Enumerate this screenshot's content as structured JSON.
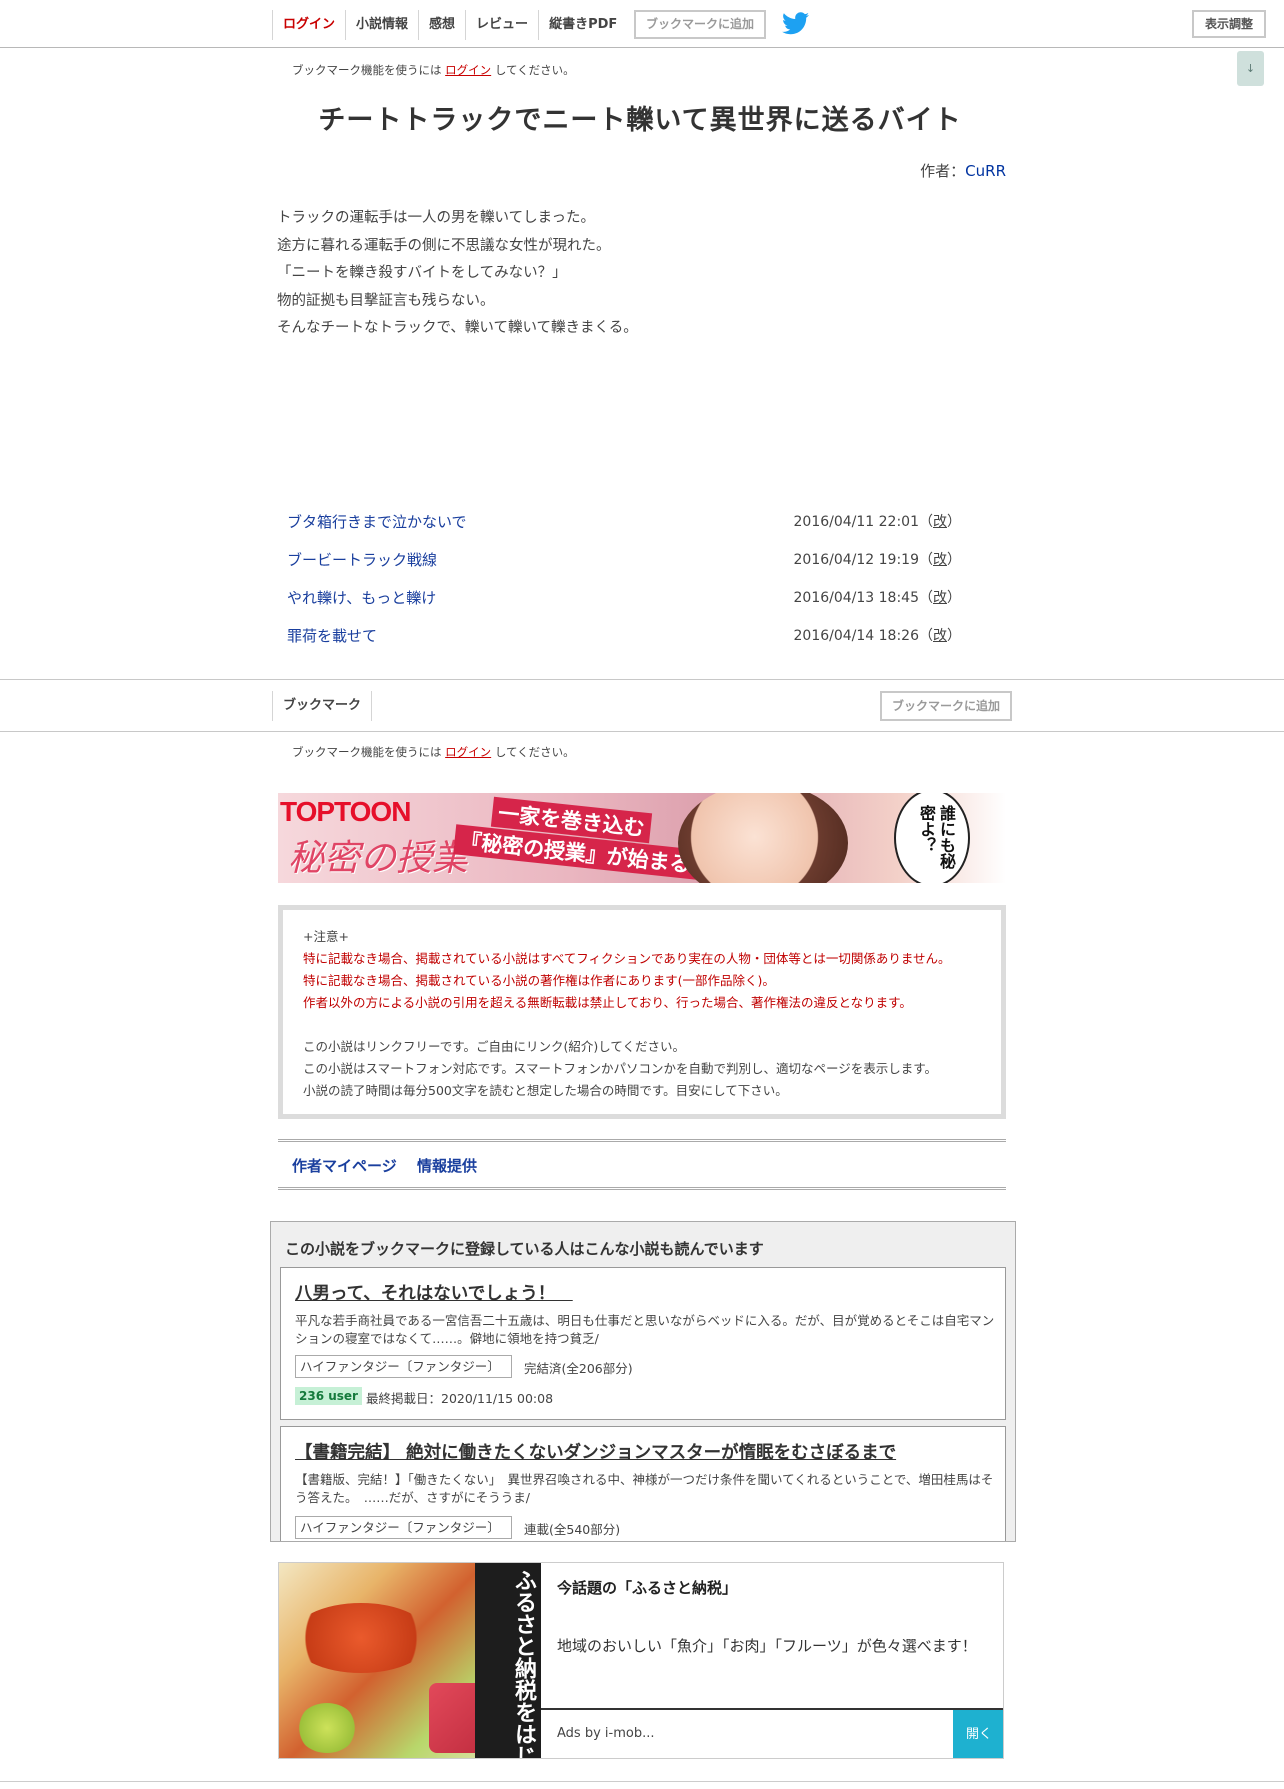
{
  "nav": {
    "items": [
      "ログイン",
      "小説情報",
      "感想",
      "レビュー",
      "縦書きPDF"
    ],
    "bookmark_add": "ブックマークに追加",
    "display_settings": "表示調整",
    "scroll_down": "↓"
  },
  "login_hint": {
    "prefix": "ブックマーク機能を使うには",
    "link": "ログイン",
    "suffix": "してください。"
  },
  "novel": {
    "title": "チートトラックでニート轢いて異世界に送るバイト",
    "author_label": "作者：",
    "author": "CuRR",
    "synopsis": [
      "トラックの運転手は一人の男を轢いてしまった。",
      "途方に暮れる運転手の側に不思議な女性が現れた。",
      "「ニートを轢き殺すバイトをしてみない？」",
      "物的証拠も目撃証言も残らない。",
      "そんなチートなトラックで、轢いて轢いて轢きまくる。"
    ]
  },
  "chapters": [
    {
      "title": "ブタ箱行きまで泣かないで",
      "date": "2016/04/11 22:01",
      "kai": "改"
    },
    {
      "title": "ブービートラック戦線",
      "date": "2016/04/12 19:19",
      "kai": "改"
    },
    {
      "title": "やれ轢け、もっと轢け",
      "date": "2016/04/13 18:45",
      "kai": "改"
    },
    {
      "title": "罪荷を載せて",
      "date": "2016/04/14 18:26",
      "kai": "改"
    }
  ],
  "bookmark_bar": {
    "tab": "ブックマーク",
    "add": "ブックマークに追加"
  },
  "ad_banner": {
    "logo": "TOPTOON",
    "logo_sub": "秘密の授業",
    "catch1": "一家を巻き込む",
    "catch2": "『秘密の授業』が始まる！",
    "bubble": "誰にも秘密よ？"
  },
  "notice": {
    "heading": "+注意+",
    "red_lines": [
      "特に記載なき場合、掲載されている小説はすべてフィクションであり実在の人物・団体等とは一切関係ありません。",
      "特に記載なき場合、掲載されている小説の著作権は作者にあります(一部作品除く)。",
      "作者以外の方による小説の引用を超える無断転載は禁止しており、行った場合、著作権法の違反となります。"
    ],
    "lines": [
      "この小説はリンクフリーです。ご自由にリンク(紹介)してください。",
      "この小説はスマートフォン対応です。スマートフォンかパソコンかを自動で判別し、適切なページを表示します。",
      "小説の読了時間は毎分500文字を読むと想定した場合の時間です。目安にして下さい。"
    ]
  },
  "author_links": {
    "mypage": "作者マイページ",
    "info": "情報提供"
  },
  "recommend": {
    "heading": "この小説をブックマークに登録している人はこんな小説も読んでいます",
    "items": [
      {
        "title": "八男って、それはないでしょう！　",
        "desc": "平凡な若手商社員である一宮信吾二十五歳は、明日も仕事だと思いながらベッドに入る。だが、目が覚めるとそこは自宅マンションの寝室ではなくて……。僻地に領地を持つ貧乏/",
        "genre": "ハイファンタジー〔ファンタジー〕",
        "status": "完結済(全206部分)",
        "users": "236 user",
        "last": "最終掲載日：2020/11/15 00:08"
      },
      {
        "title": "【書籍完結】 絶対に働きたくないダンジョンマスターが惰眠をむさぼるまで",
        "desc": "【書籍版、完結！】「働きたくない」　異世界召喚される中、神様が一つだけ条件を聞いてくれるということで、増田桂馬はそう答えた。　……だが、さすがにそううま/",
        "genre": "ハイファンタジー〔ファンタジー〕",
        "status": "連載(全540部分)"
      }
    ]
  },
  "ad2": {
    "image_text": "ふるさと納税をはじめよう",
    "title": "今話題の「ふるさと納税」",
    "desc": "地域のおいしい「魚介」「お肉」「フルーツ」が色々選べます！",
    "by": "Ads by i-mob...",
    "open": "開く"
  },
  "colors": {
    "login_red": "#c80000",
    "link_blue": "#1a3f9e",
    "notice_red": "#c00000",
    "user_badge_bg": "#c6f0d6",
    "open_button": "#1eb1d0",
    "twitter": "#1da1f2"
  }
}
